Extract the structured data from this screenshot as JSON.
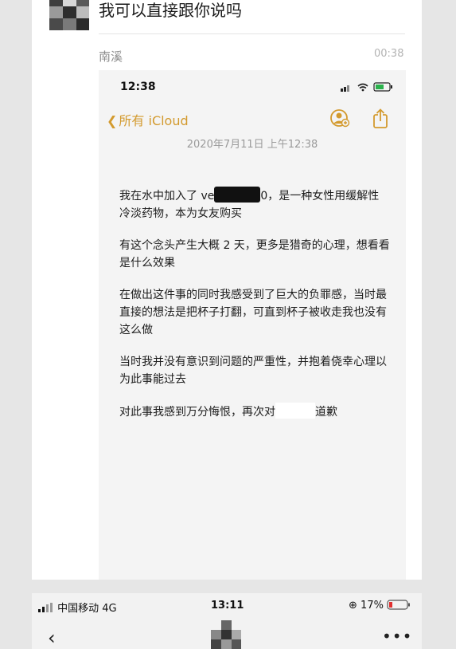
{
  "message": {
    "text": "我可以直接跟你说吗",
    "sender": "南溪",
    "time": "00:38"
  },
  "screenshot": {
    "status_time": "12:38",
    "back_label": "所有 iCloud",
    "note_date": "2020年7月11日 上午12:38",
    "paragraphs": {
      "p1_a": "我在水中加入了 ve",
      "p1_b": "0，是一种女性用缓解性冷淡药物，本为女友购买",
      "p2": "有这个念头产生大概 2 天，更多是猎奇的心理，想看看是什么效果",
      "p3": "在做出这件事的同时我感受到了巨大的负罪感，当时最直接的想法是把杯子打翻，可直到杯子被收走我也没有这么做",
      "p4": "当时我并没有意识到问题的严重性，并抱着侥幸心理以为此事能过去",
      "p5_a": "对此事我感到万分悔恨，再次对",
      "p5_b": "道歉"
    },
    "accent": "#d39a2e"
  },
  "bottom_bar": {
    "carrier": "中国移动  4G",
    "time": "13:11",
    "battery": "17%",
    "battery_color": "#e03030",
    "back_icon": "‹",
    "more_icon": "•••"
  }
}
